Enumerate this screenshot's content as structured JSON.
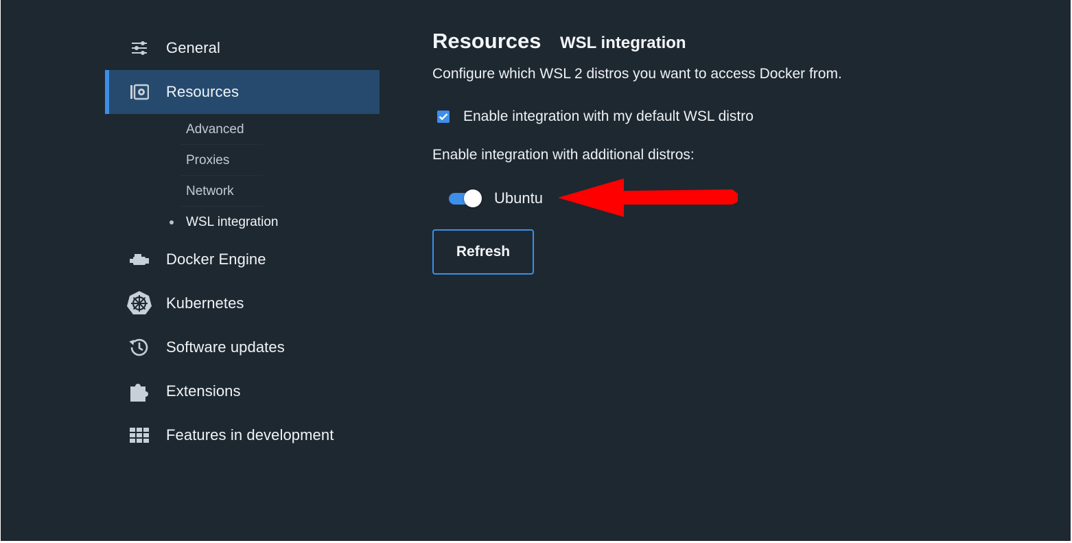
{
  "sidebar": {
    "items": [
      {
        "label": "General",
        "icon": "sliders-icon"
      },
      {
        "label": "Resources",
        "icon": "resources-icon",
        "active": true
      },
      {
        "label": "Docker Engine",
        "icon": "engine-icon"
      },
      {
        "label": "Kubernetes",
        "icon": "kubernetes-icon"
      },
      {
        "label": "Software updates",
        "icon": "history-icon"
      },
      {
        "label": "Extensions",
        "icon": "puzzle-icon"
      },
      {
        "label": "Features in development",
        "icon": "grid-icon"
      }
    ],
    "resources_subitems": [
      {
        "label": "Advanced"
      },
      {
        "label": "Proxies"
      },
      {
        "label": "Network"
      },
      {
        "label": "WSL integration",
        "current": true
      }
    ]
  },
  "main": {
    "title": "Resources",
    "subtitle": "WSL integration",
    "description": "Configure which WSL 2 distros you want to access Docker from.",
    "default_distro": {
      "label": "Enable integration with my default WSL distro",
      "checked": true
    },
    "additional_label": "Enable integration with additional distros:",
    "distros": [
      {
        "name": "Ubuntu",
        "enabled": true
      }
    ],
    "refresh_label": "Refresh"
  },
  "colors": {
    "background": "#1e2831",
    "active_item": "#264a6e",
    "accent": "#3d8fe8",
    "annotation_arrow": "#ff0000"
  }
}
